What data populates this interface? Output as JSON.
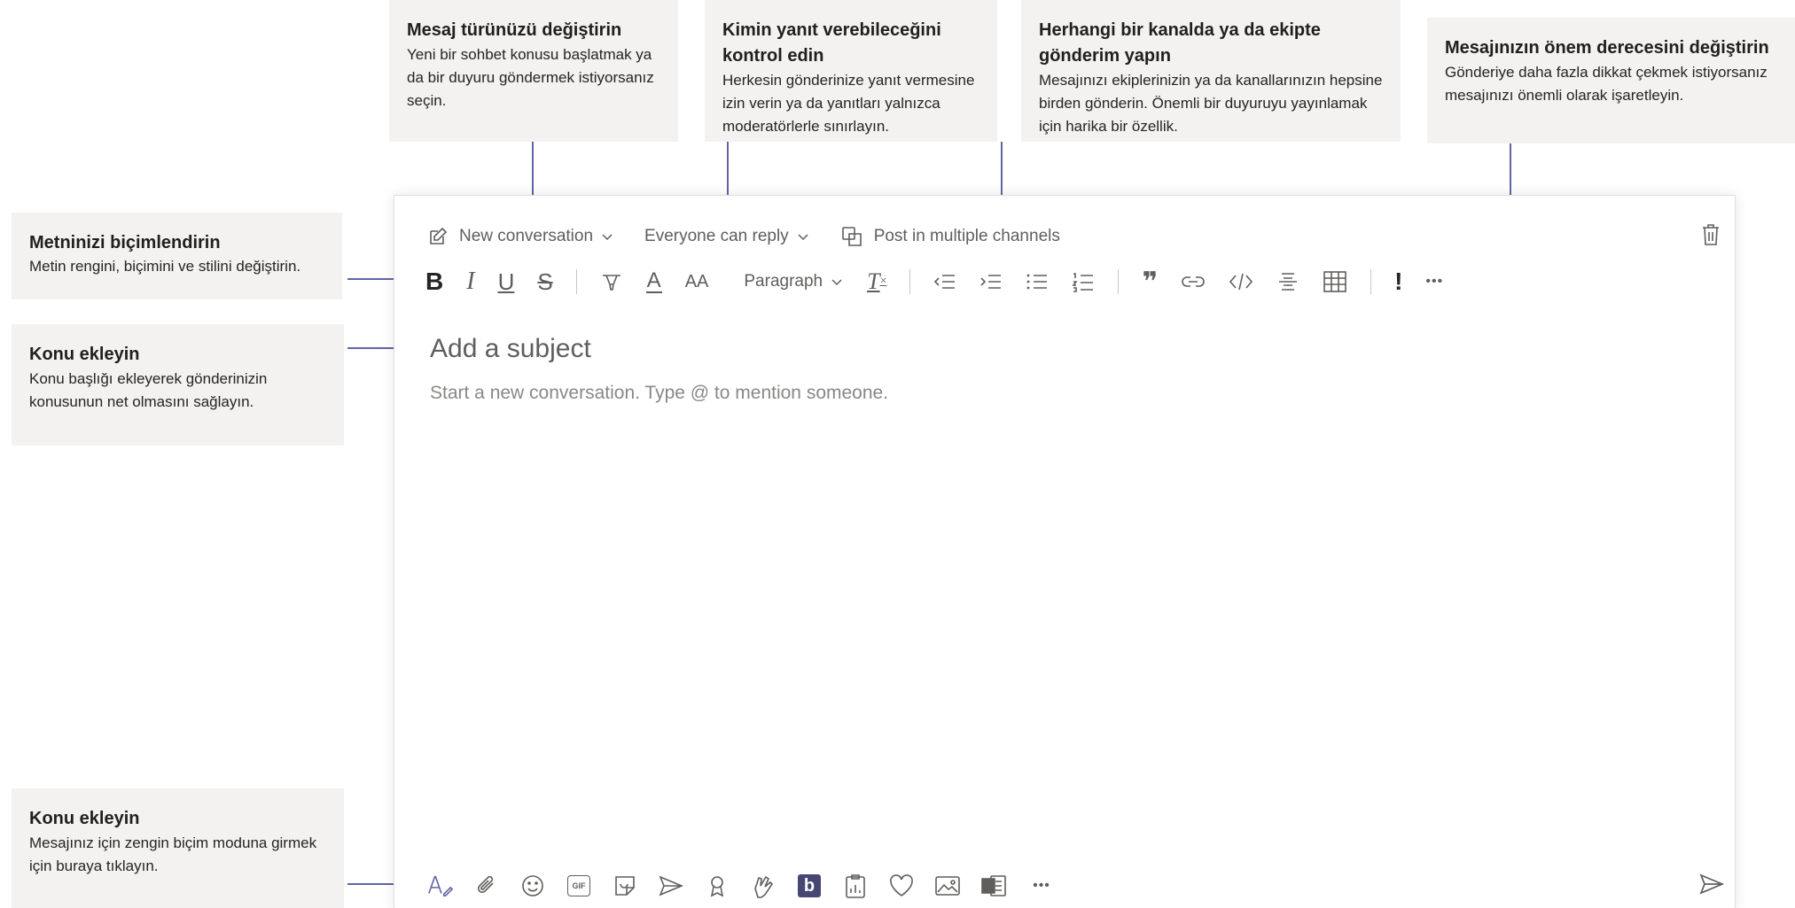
{
  "callouts": {
    "message_type": {
      "title": "Mesaj türünüzü değiştirin",
      "body": "Yeni bir sohbet konusu başlatmak ya da bir duyuru göndermek istiyorsanız seçin."
    },
    "who_can_reply": {
      "title": "Kimin yanıt verebileceğini kontrol edin",
      "body": "Herkesin gönderinize yanıt vermesine izin verin ya da yanıtları yalnızca moderatörlerle sınırlayın."
    },
    "multi_channel": {
      "title": "Herhangi bir kanalda ya da ekipte gönderim yapın",
      "body": "Mesajınızı ekiplerinizin ya da kanallarınızın hepsine birden gönderin. Önemli bir duyuruyu yayınlamak için harika bir özellik."
    },
    "importance": {
      "title": "Mesajınızın önem derecesini değiştirin",
      "body": "Gönderiye daha fazla dikkat çekmek istiyorsanız mesajınızı önemli olarak işaretleyin."
    },
    "format_text": {
      "title": "Metninizi biçimlendirin",
      "body": "Metin rengini, biçimini ve stilini değiştirin."
    },
    "add_subject": {
      "title": "Konu ekleyin",
      "body": "Konu başlığı ekleyerek gönderinizin konusunun net olmasını sağlayın."
    },
    "rich_format": {
      "title": "Konu ekleyin",
      "body": "Mesajınız için zengin biçim moduna girmek için buraya tıklayın."
    }
  },
  "toolbar": {
    "new_conversation": "New conversation",
    "everyone_can_reply": "Everyone can reply",
    "post_multiple": "Post in multiple channels",
    "paragraph": "Paragraph",
    "bold": "B",
    "italic": "I",
    "underline": "U",
    "strike": "S",
    "font_color": "A",
    "font_size": "AA",
    "clear_format": "T",
    "quote": "❞",
    "important": "!",
    "more": "•••"
  },
  "compose": {
    "subject_placeholder": "Add a subject",
    "body_placeholder": "Start a new conversation. Type @ to mention someone."
  },
  "bottom": {
    "gif": "GIF",
    "more": "•••"
  },
  "colors": {
    "accent": "#6264a7",
    "callout_bg": "#f3f2f1",
    "icon": "#605e5c"
  }
}
